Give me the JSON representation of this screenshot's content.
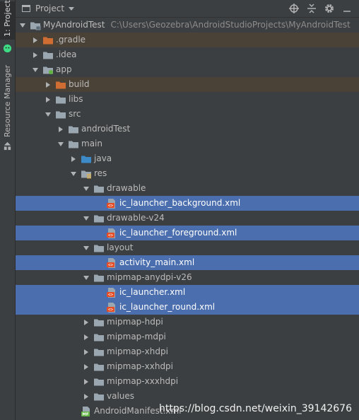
{
  "sidebar": {
    "tab_project": "1: Project",
    "tab_resource_manager": "Resource Manager"
  },
  "header": {
    "title": "Project"
  },
  "tree": [
    {
      "label": "MyAndroidTest",
      "path": "C:\\Users\\Geozebra\\AndroidStudioProjects\\MyAndroidTest",
      "depth": 0,
      "expanded": true,
      "icon": "project-folder-icon"
    },
    {
      "label": ".gradle",
      "depth": 1,
      "expanded": false,
      "icon": "excluded-folder-icon",
      "excluded": true
    },
    {
      "label": ".idea",
      "depth": 1,
      "expanded": false,
      "icon": "folder-icon"
    },
    {
      "label": "app",
      "depth": 1,
      "expanded": true,
      "icon": "module-folder-icon"
    },
    {
      "label": "build",
      "depth": 2,
      "expanded": false,
      "icon": "excluded-folder-icon",
      "excluded": true
    },
    {
      "label": "libs",
      "depth": 2,
      "expanded": false,
      "icon": "folder-icon"
    },
    {
      "label": "src",
      "depth": 2,
      "expanded": true,
      "icon": "folder-icon"
    },
    {
      "label": "androidTest",
      "depth": 3,
      "expanded": false,
      "icon": "folder-icon"
    },
    {
      "label": "main",
      "depth": 3,
      "expanded": true,
      "icon": "folder-icon"
    },
    {
      "label": "java",
      "depth": 4,
      "expanded": false,
      "icon": "source-folder-icon"
    },
    {
      "label": "res",
      "depth": 4,
      "expanded": true,
      "icon": "resource-folder-icon"
    },
    {
      "label": "drawable",
      "depth": 5,
      "expanded": true,
      "icon": "folder-icon"
    },
    {
      "label": "ic_launcher_background.xml",
      "depth": 6,
      "leaf": true,
      "icon": "xml-file-icon",
      "selected": true
    },
    {
      "label": "drawable-v24",
      "depth": 5,
      "expanded": true,
      "icon": "folder-icon"
    },
    {
      "label": "ic_launcher_foreground.xml",
      "depth": 6,
      "leaf": true,
      "icon": "xml-file-icon",
      "selected": true
    },
    {
      "label": "layout",
      "depth": 5,
      "expanded": true,
      "icon": "folder-icon"
    },
    {
      "label": "activity_main.xml",
      "depth": 6,
      "leaf": true,
      "icon": "xml-file-icon",
      "selected": true
    },
    {
      "label": "mipmap-anydpi-v26",
      "depth": 5,
      "expanded": true,
      "icon": "folder-icon"
    },
    {
      "label": "ic_launcher.xml",
      "depth": 6,
      "leaf": true,
      "icon": "xml-file-icon",
      "selected": true
    },
    {
      "label": "ic_launcher_round.xml",
      "depth": 6,
      "leaf": true,
      "icon": "xml-file-icon",
      "selected": true
    },
    {
      "label": "mipmap-hdpi",
      "depth": 5,
      "expanded": false,
      "icon": "folder-icon"
    },
    {
      "label": "mipmap-mdpi",
      "depth": 5,
      "expanded": false,
      "icon": "folder-icon"
    },
    {
      "label": "mipmap-xhdpi",
      "depth": 5,
      "expanded": false,
      "icon": "folder-icon"
    },
    {
      "label": "mipmap-xxhdpi",
      "depth": 5,
      "expanded": false,
      "icon": "folder-icon"
    },
    {
      "label": "mipmap-xxxhdpi",
      "depth": 5,
      "expanded": false,
      "icon": "folder-icon"
    },
    {
      "label": "values",
      "depth": 5,
      "expanded": false,
      "icon": "folder-icon"
    },
    {
      "label": "AndroidManifest.xml",
      "depth": 4,
      "leaf": true,
      "icon": "manifest-file-icon"
    }
  ],
  "watermark": "https://blog.csdn.net/weixin_39142676",
  "colors": {
    "background": "#3c3f41",
    "selection": "#4b6eaf",
    "excluded_row": "#4a4237",
    "folder": "#9aa7b0",
    "excluded_folder": "#d06d32",
    "source_folder": "#3d8ac8",
    "xml_file": "#e44d26"
  }
}
